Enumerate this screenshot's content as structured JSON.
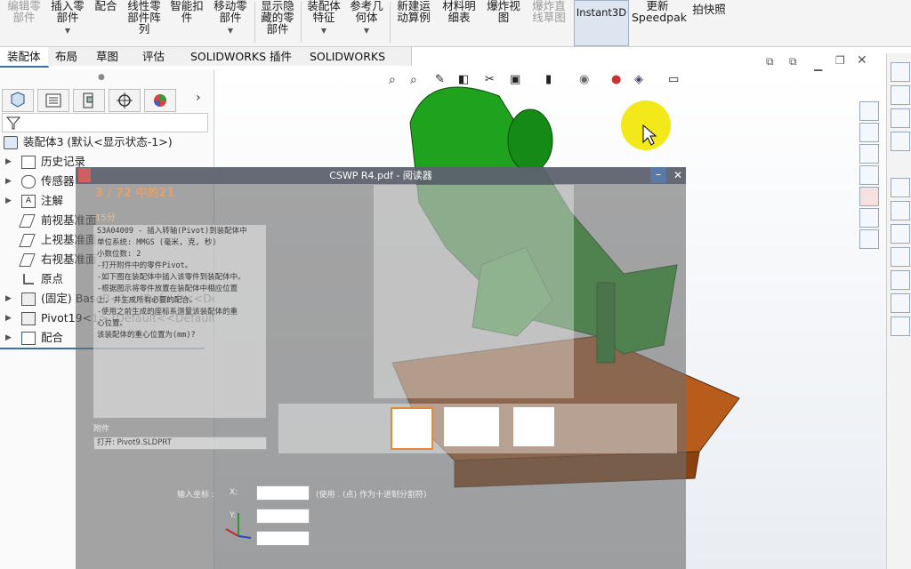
{
  "ribbon": {
    "items": [
      {
        "id": "edit-part",
        "label": "编辑零\n部件",
        "disabled": true
      },
      {
        "id": "insert-parts",
        "label": "插入零\n部件",
        "disabled": false
      },
      {
        "id": "mate",
        "label": "配合",
        "disabled": false
      },
      {
        "id": "linear-pattern",
        "label": "线性零\n部件阵\n列",
        "disabled": false
      },
      {
        "id": "smart-fastener",
        "label": "智能扣\n件",
        "disabled": false
      },
      {
        "id": "move-component",
        "label": "移动零\n部件",
        "disabled": false
      },
      {
        "id": "show-hidden",
        "label": "显示隐\n藏的零\n部件",
        "disabled": false
      },
      {
        "id": "assembly-feature",
        "label": "装配体\n特征",
        "disabled": false
      },
      {
        "id": "ref-geometry",
        "label": "参考几\n何体",
        "disabled": false
      },
      {
        "id": "new-motion-study",
        "label": "新建运\n动算例",
        "disabled": false
      },
      {
        "id": "bom",
        "label": "材料明\n细表",
        "disabled": false
      },
      {
        "id": "exploded-view",
        "label": "爆炸视\n图",
        "disabled": false
      },
      {
        "id": "explode-line",
        "label": "爆炸直\n线草图",
        "disabled": true
      },
      {
        "id": "instant3d",
        "label": "Instant3D",
        "disabled": false
      },
      {
        "id": "speedpak",
        "label": "更新\nSpeedpak",
        "disabled": false
      },
      {
        "id": "snapshot",
        "label": "拍快照",
        "disabled": false
      }
    ]
  },
  "tabs": [
    "装配体",
    "布局",
    "草图",
    "评估",
    "SOLIDWORKS 插件",
    "SOLIDWORKS MBD"
  ],
  "tree": {
    "filter_icon": "filter-icon",
    "root": "装配体3  (默认<显示状态-1>)",
    "items": [
      "历史记录",
      "传感器",
      "注解",
      "前视基准面",
      "上视基准面",
      "右视基准面",
      "原点",
      "(固定) BaseB<1> (Default<<Def",
      "Pivot19<1> (Default<<Default",
      "配合"
    ]
  },
  "viewport_toolbar_icons": [
    "zoom-fit-icon",
    "zoom-area-icon",
    "previous-view-icon",
    "section-view-icon",
    "view-orientation-icon",
    "display-style-icon",
    "hide-show-icon",
    "appearance-icon",
    "scene-icon",
    "display-settings-icon"
  ],
  "overlay": {
    "title": "CSWP R4.pdf - 阅读器",
    "progress": "3 / 72 中的21",
    "points": "15分",
    "question_lines": [
      "S3A04009 - 插入转轴(Pivot)到装配体中",
      "单位系统: MMGS (毫米, 克, 秒)",
      "小数位数: 2",
      "",
      "-打开附件中的零件Pivot。",
      "",
      "-如下图在装配体中插入该零件到装配体中。",
      "",
      "-根据图示将零件放置在装配体中相应位置",
      "上, 并生成所有必要的配合。",
      "",
      "-使用之前生成的座标系测量该装配体的重",
      "心位置。",
      "",
      "该装配体的重心位置为(mm)?"
    ],
    "attachment_label": "附件",
    "attachment_file": "打开: Pivot9.SLDPRT",
    "coord_label": "输入坐标 :",
    "x_label": "X:",
    "y_label": "Y:",
    "z_label": "Z:",
    "hint": "(使用 . (点) 作为十进制分割符)",
    "x_value": "",
    "y_value": "",
    "z_value": ""
  },
  "window_controls": [
    "restore-icon",
    "minimize-icon",
    "maximize-icon",
    "close-icon"
  ],
  "colors": {
    "part_green": "#1fa31f",
    "base_orange": "#c8621a",
    "accent": "#3a6ea8",
    "cursor_highlight": "#f2e81a"
  }
}
